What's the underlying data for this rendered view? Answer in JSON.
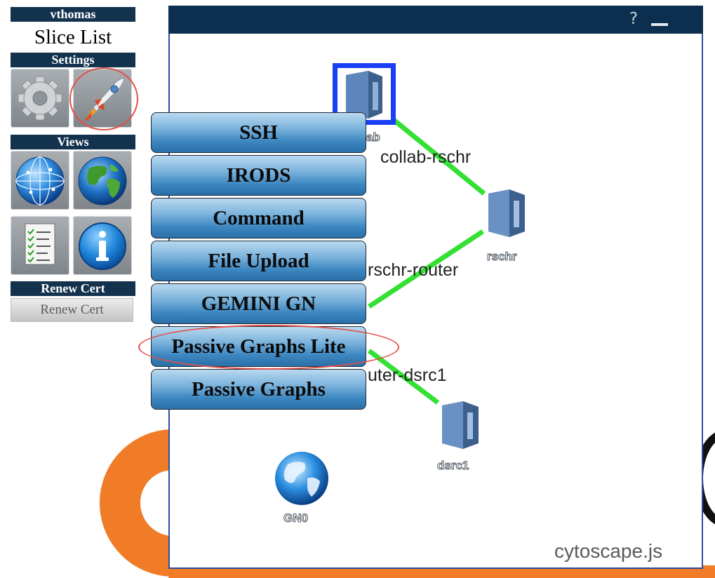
{
  "sidebar": {
    "username": "vthomas",
    "slice_list_label": "Slice List",
    "settings_header": "Settings",
    "views_header": "Views",
    "renew_header": "Renew Cert",
    "renew_button": "Renew Cert",
    "tiles": [
      {
        "icon": "gear-icon"
      },
      {
        "icon": "rocket-icon"
      },
      {
        "icon": "network-globe-icon"
      },
      {
        "icon": "earth-globe-icon"
      },
      {
        "icon": "checklist-icon"
      },
      {
        "icon": "info-icon"
      }
    ]
  },
  "panel": {
    "help": "?",
    "watermark": "cytoscape.js"
  },
  "graph": {
    "edges": [
      {
        "label": "collab-rschr"
      },
      {
        "label": "rschr-router"
      },
      {
        "label": "uter-dsrc1"
      }
    ],
    "nodes": [
      {
        "label": "ab"
      },
      {
        "label": "rschr"
      },
      {
        "label": "dsrc1"
      },
      {
        "label": "GN0"
      }
    ],
    "edge_color": "#33e033",
    "selection_color": "#1a3ff5"
  },
  "launch_menu": {
    "items": [
      "SSH",
      "IRODS",
      "Command",
      "File Upload",
      "GEMINI GN",
      "Passive Graphs Lite",
      "Passive Graphs"
    ],
    "highlighted": "Passive Graphs Lite"
  },
  "colors": {
    "header_bg": "#13324e",
    "panel_titlebar": "#0c2f4f",
    "annotation_red": "#e2504a",
    "logo_orange": "#f07c28"
  }
}
